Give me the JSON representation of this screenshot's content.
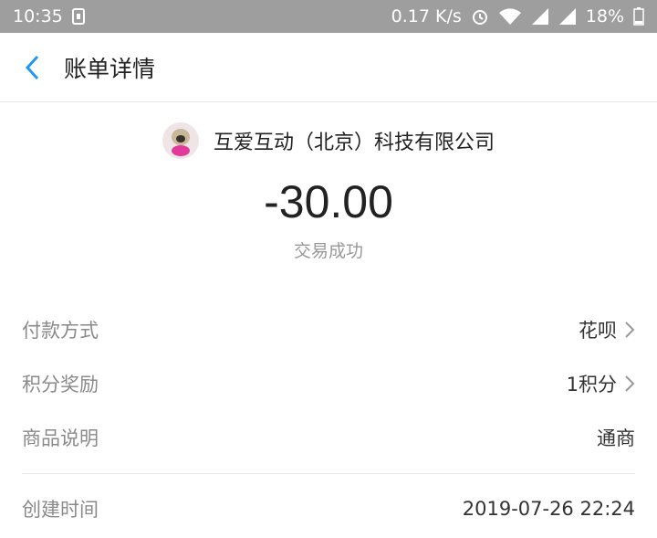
{
  "statusbar": {
    "time": "10:35",
    "speed": "0.17 K/s",
    "battery": "18%"
  },
  "nav": {
    "title": "账单详情"
  },
  "merchant": {
    "name": "互爱互动（北京）科技有限公司"
  },
  "amount": "-30.00",
  "status": "交易成功",
  "details": [
    {
      "label": "付款方式",
      "value": "花呗"
    },
    {
      "label": "积分奖励",
      "value": "1积分"
    },
    {
      "label": "商品说明",
      "value": "通商"
    },
    {
      "label": "创建时间",
      "value": "2019-07-26 22:24"
    }
  ],
  "colors": {
    "accent": "#2196f3",
    "statusbar": "#9e9e9e"
  }
}
